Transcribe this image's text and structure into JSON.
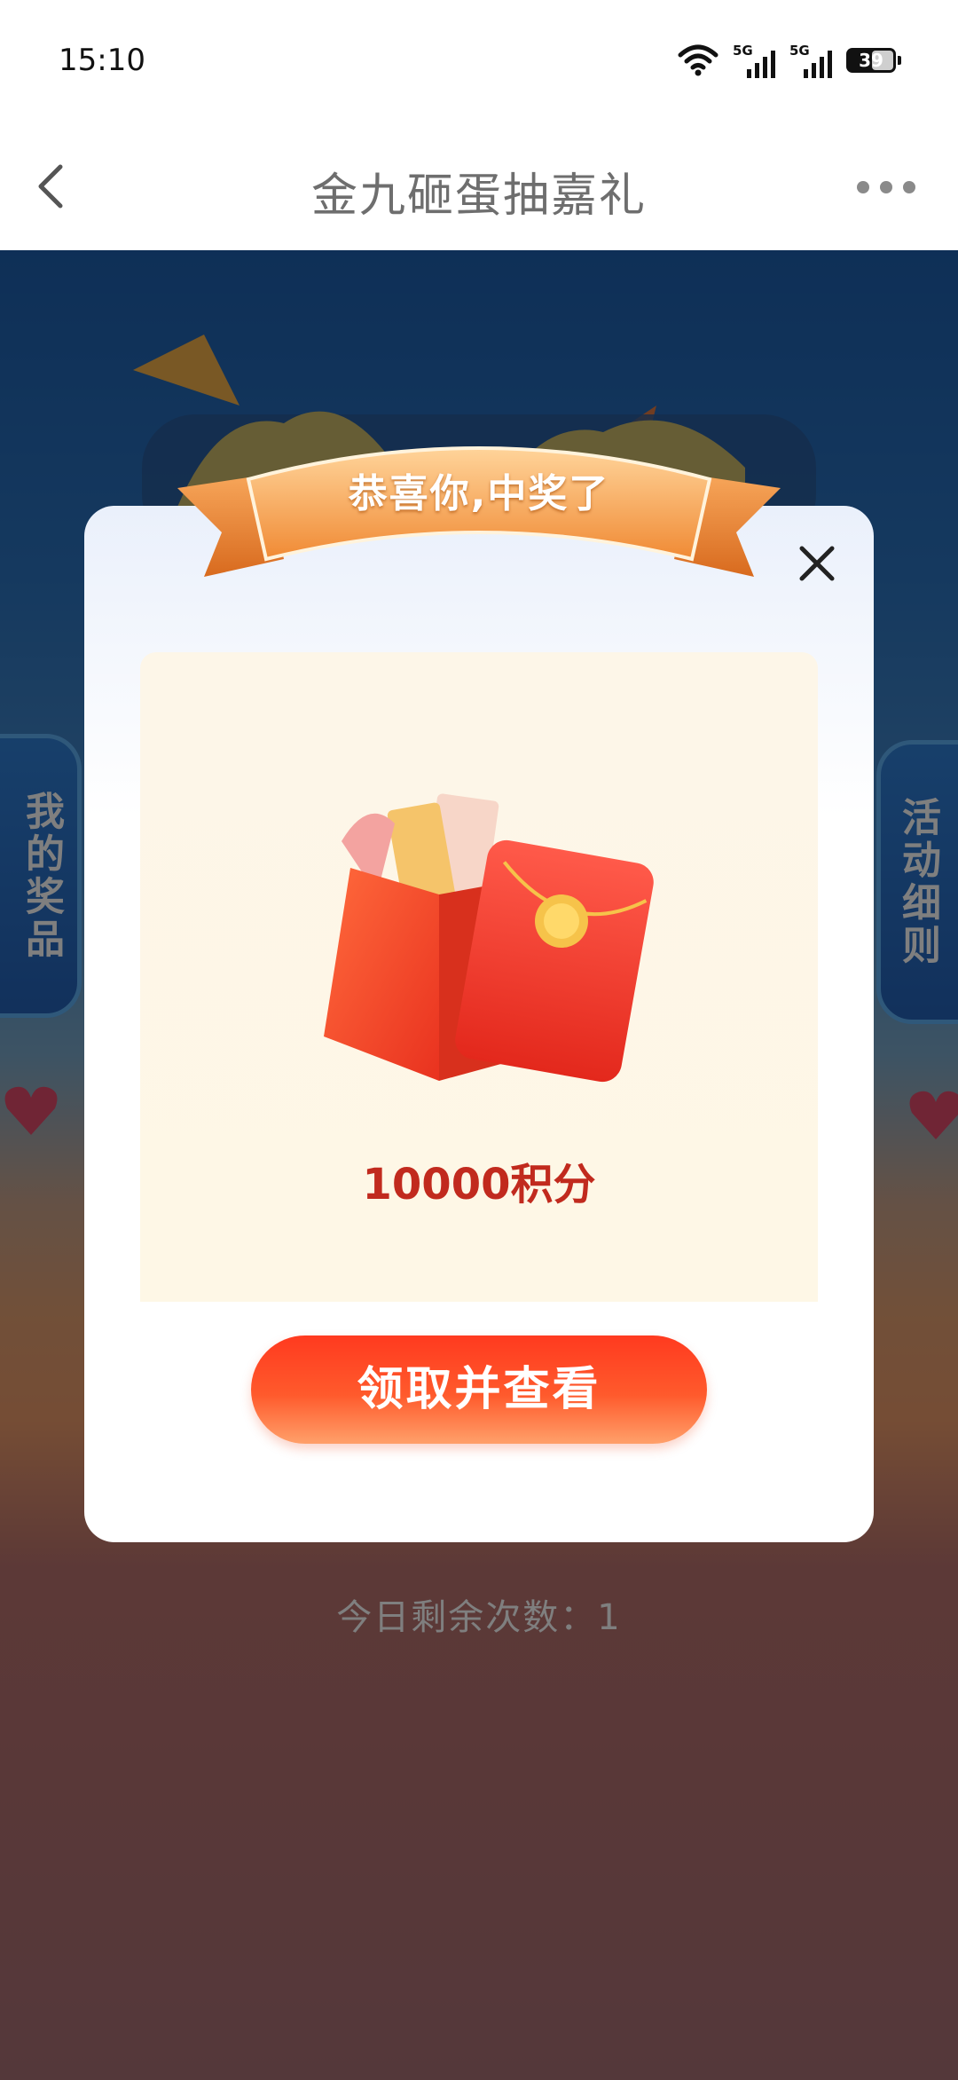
{
  "status_bar": {
    "time": "15:10",
    "battery": "39",
    "net1": "5G",
    "net2": "5G"
  },
  "nav": {
    "title": "金九砸蛋抽嘉礼",
    "back_icon": "back-arrow-icon",
    "more_icon": "more-dots-icon"
  },
  "background": {
    "left_tab": "我的奖品",
    "right_tab": "活动细则",
    "remaining": "今日剩余次数：1"
  },
  "dialog": {
    "banner": "恭喜你,中奖了",
    "prize": "10000积分",
    "claim_button": "领取并查看"
  },
  "colors": {
    "primary_red": "#c12a1e",
    "button_red": "#ff3a1f",
    "nav_title": "#6e6e6e"
  }
}
